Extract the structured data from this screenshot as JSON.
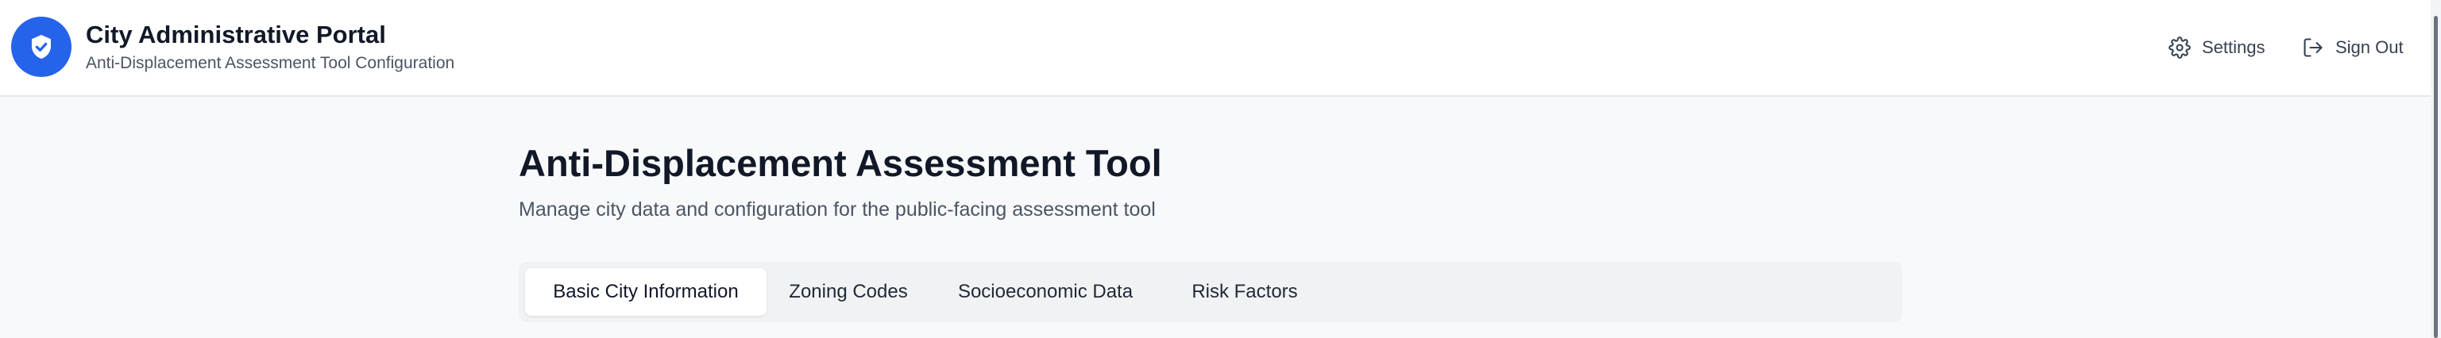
{
  "header": {
    "title": "City Administrative Portal",
    "subtitle": "Anti-Displacement Assessment Tool Configuration",
    "logo_icon": "shield-check-icon",
    "actions": [
      {
        "label": "Settings",
        "icon": "gear-icon"
      },
      {
        "label": "Sign Out",
        "icon": "sign-out-icon"
      }
    ]
  },
  "main": {
    "title": "Anti-Displacement Assessment Tool",
    "description": "Manage city data and configuration for the public-facing assessment tool",
    "tabs": [
      {
        "label": "Basic City Information",
        "active": true
      },
      {
        "label": "Zoning Codes",
        "active": false
      },
      {
        "label": "Socioeconomic Data",
        "active": false
      },
      {
        "label": "Risk Factors",
        "active": false
      }
    ]
  },
  "colors": {
    "accent": "#2563eb",
    "header_bg": "#ffffff",
    "page_bg": "#f8f9fb",
    "tab_bar_bg": "#f1f2f4"
  }
}
